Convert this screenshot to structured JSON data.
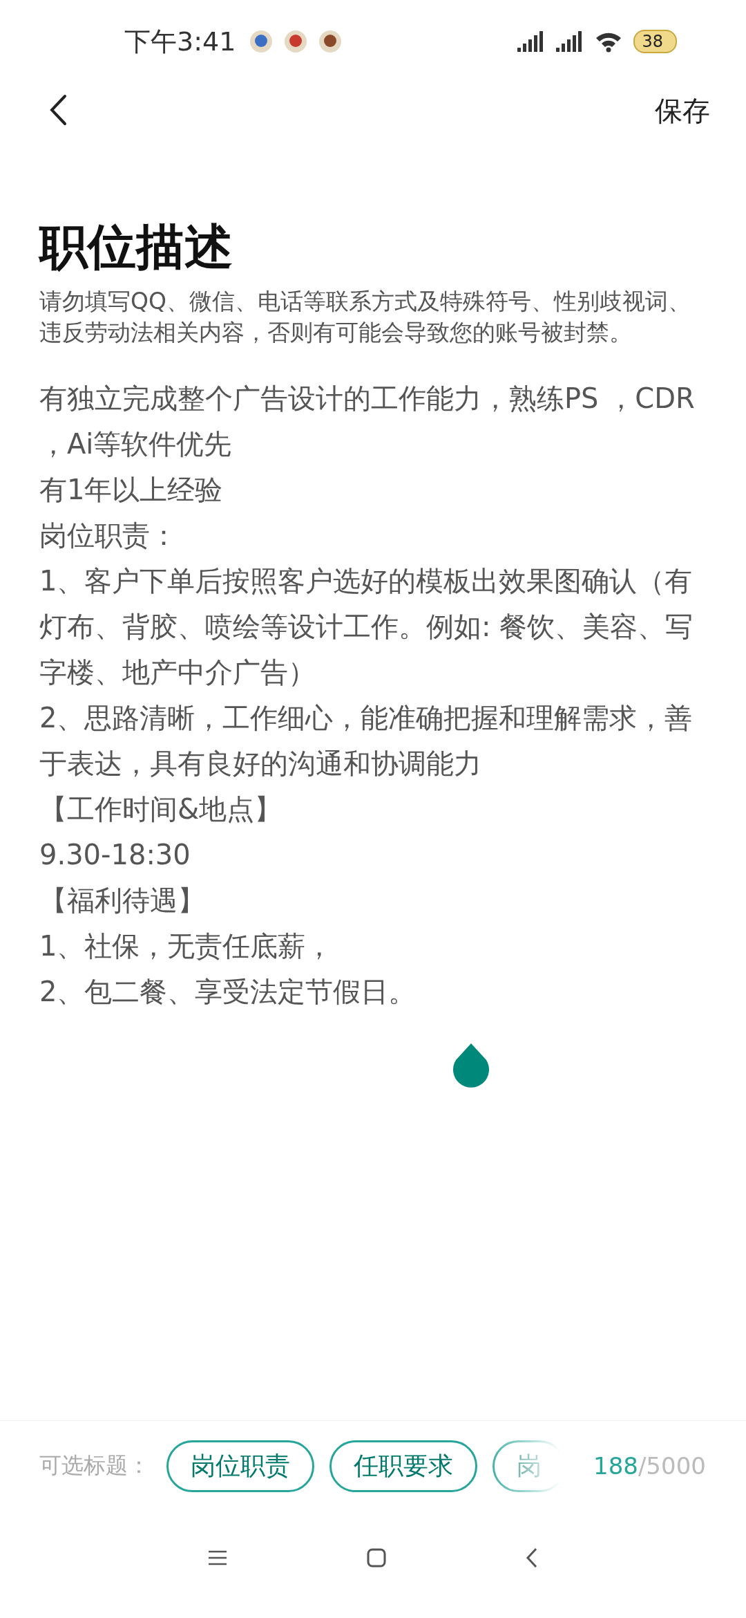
{
  "status_bar": {
    "time": "下午3:41",
    "battery": "38"
  },
  "header": {
    "save": "保存"
  },
  "title": "职位描述",
  "notice": "请勿填写QQ、微信、电话等联系方式及特殊符号、性别歧视词、违反劳动法相关内容，否则有可能会导致您的账号被封禁。",
  "description": [
    "有独立完成整个广告设计的工作能力，熟练PS ，CDR ，Ai等软件优先",
    "有1年以上经验",
    "岗位职责：",
    "1、客户下单后按照客户选好的模板出效果图确认（有灯布、背胶、喷绘等设计工作。例如: 餐饮、美容、写字楼、地产中介广告）",
    "2、思路清晰，工作细心，能准确把握和理解需求，善于表达，具有良好的沟通和协调能力",
    "【工作时间&地点】",
    "9.30-18:30",
    "【福利待遇】",
    "1、社保，无责任底薪，",
    "2、包二餐、享受法定节假日。"
  ],
  "bottom_bar": {
    "label": "可选标题：",
    "chips": [
      "岗位职责",
      "任职要求",
      "岗"
    ],
    "count": "188",
    "limit": "/5000"
  }
}
